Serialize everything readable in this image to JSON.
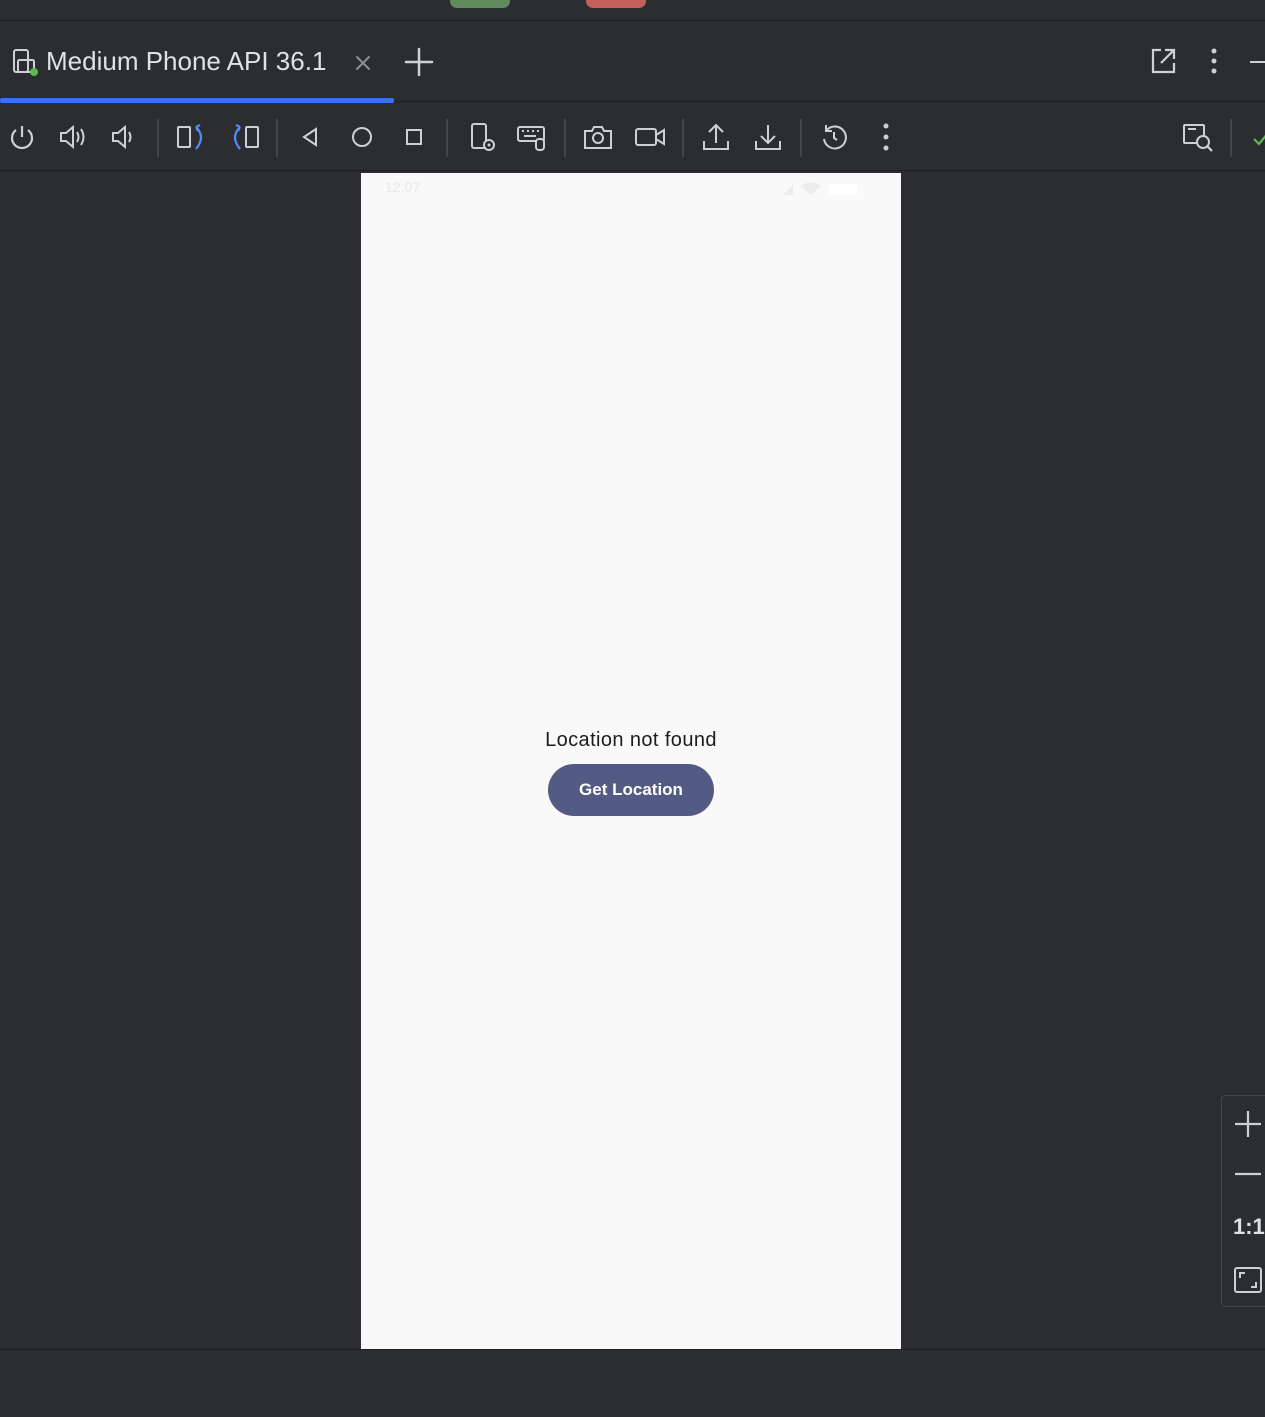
{
  "tab": {
    "title": "Medium Phone API 36.1",
    "icon": "device-icon"
  },
  "toolbar": {
    "buttons": [
      "power-icon",
      "volume-up-icon",
      "volume-down-icon",
      "rotate-left-icon",
      "rotate-right-icon",
      "back-icon",
      "home-icon",
      "overview-icon",
      "device-settings-icon",
      "keyboard-icon",
      "screenshot-icon",
      "screen-record-icon",
      "upload-icon",
      "download-icon",
      "reset-icon",
      "more-icon",
      "inspect-icon"
    ]
  },
  "phone": {
    "status_time": "12:07",
    "message": "Location not found",
    "button_label": "Get Location"
  },
  "zoom": {
    "actual_size_label": "1:1"
  },
  "colors": {
    "accent": "#3574f0",
    "button_bg": "#535b84",
    "screen_bg": "#f9f9f9",
    "ide_bg": "#2b2d30"
  }
}
